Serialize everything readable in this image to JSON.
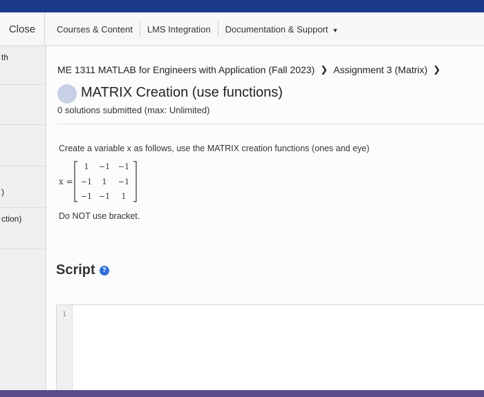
{
  "topnav": {
    "close_label": "Close",
    "links": [
      "Courses & Content",
      "LMS Integration",
      "Documentation & Support"
    ]
  },
  "sidebar": {
    "items": [
      {
        "label": "th"
      },
      {
        "label": ""
      },
      {
        "label": ""
      },
      {
        "label": ")"
      },
      {
        "label": "ction)"
      },
      {
        "label": ""
      }
    ]
  },
  "breadcrumb": {
    "course": "ME 1311 MATLAB for Engineers with Application (Fall 2023)",
    "assignment": "Assignment 3 (Matrix)"
  },
  "problem": {
    "title": "MATRIX Creation (use functions)",
    "submissions": "0 solutions submitted (max: Unlimited)",
    "prompt": "Create a variable x as follows, use the MATRIX creation functions (ones and eye)",
    "matrix_var": "x =",
    "matrix": [
      [
        "1",
        "−1",
        "−1"
      ],
      [
        "−1",
        "1",
        "−1"
      ],
      [
        "−1",
        "−1",
        "1"
      ]
    ],
    "note": "Do NOT use bracket."
  },
  "script": {
    "heading": "Script",
    "line_numbers": [
      "1"
    ]
  },
  "colors": {
    "top_strip": "#1c3a8a",
    "help_icon": "#2f6fd6",
    "status_dot": "#c7d0e6"
  }
}
